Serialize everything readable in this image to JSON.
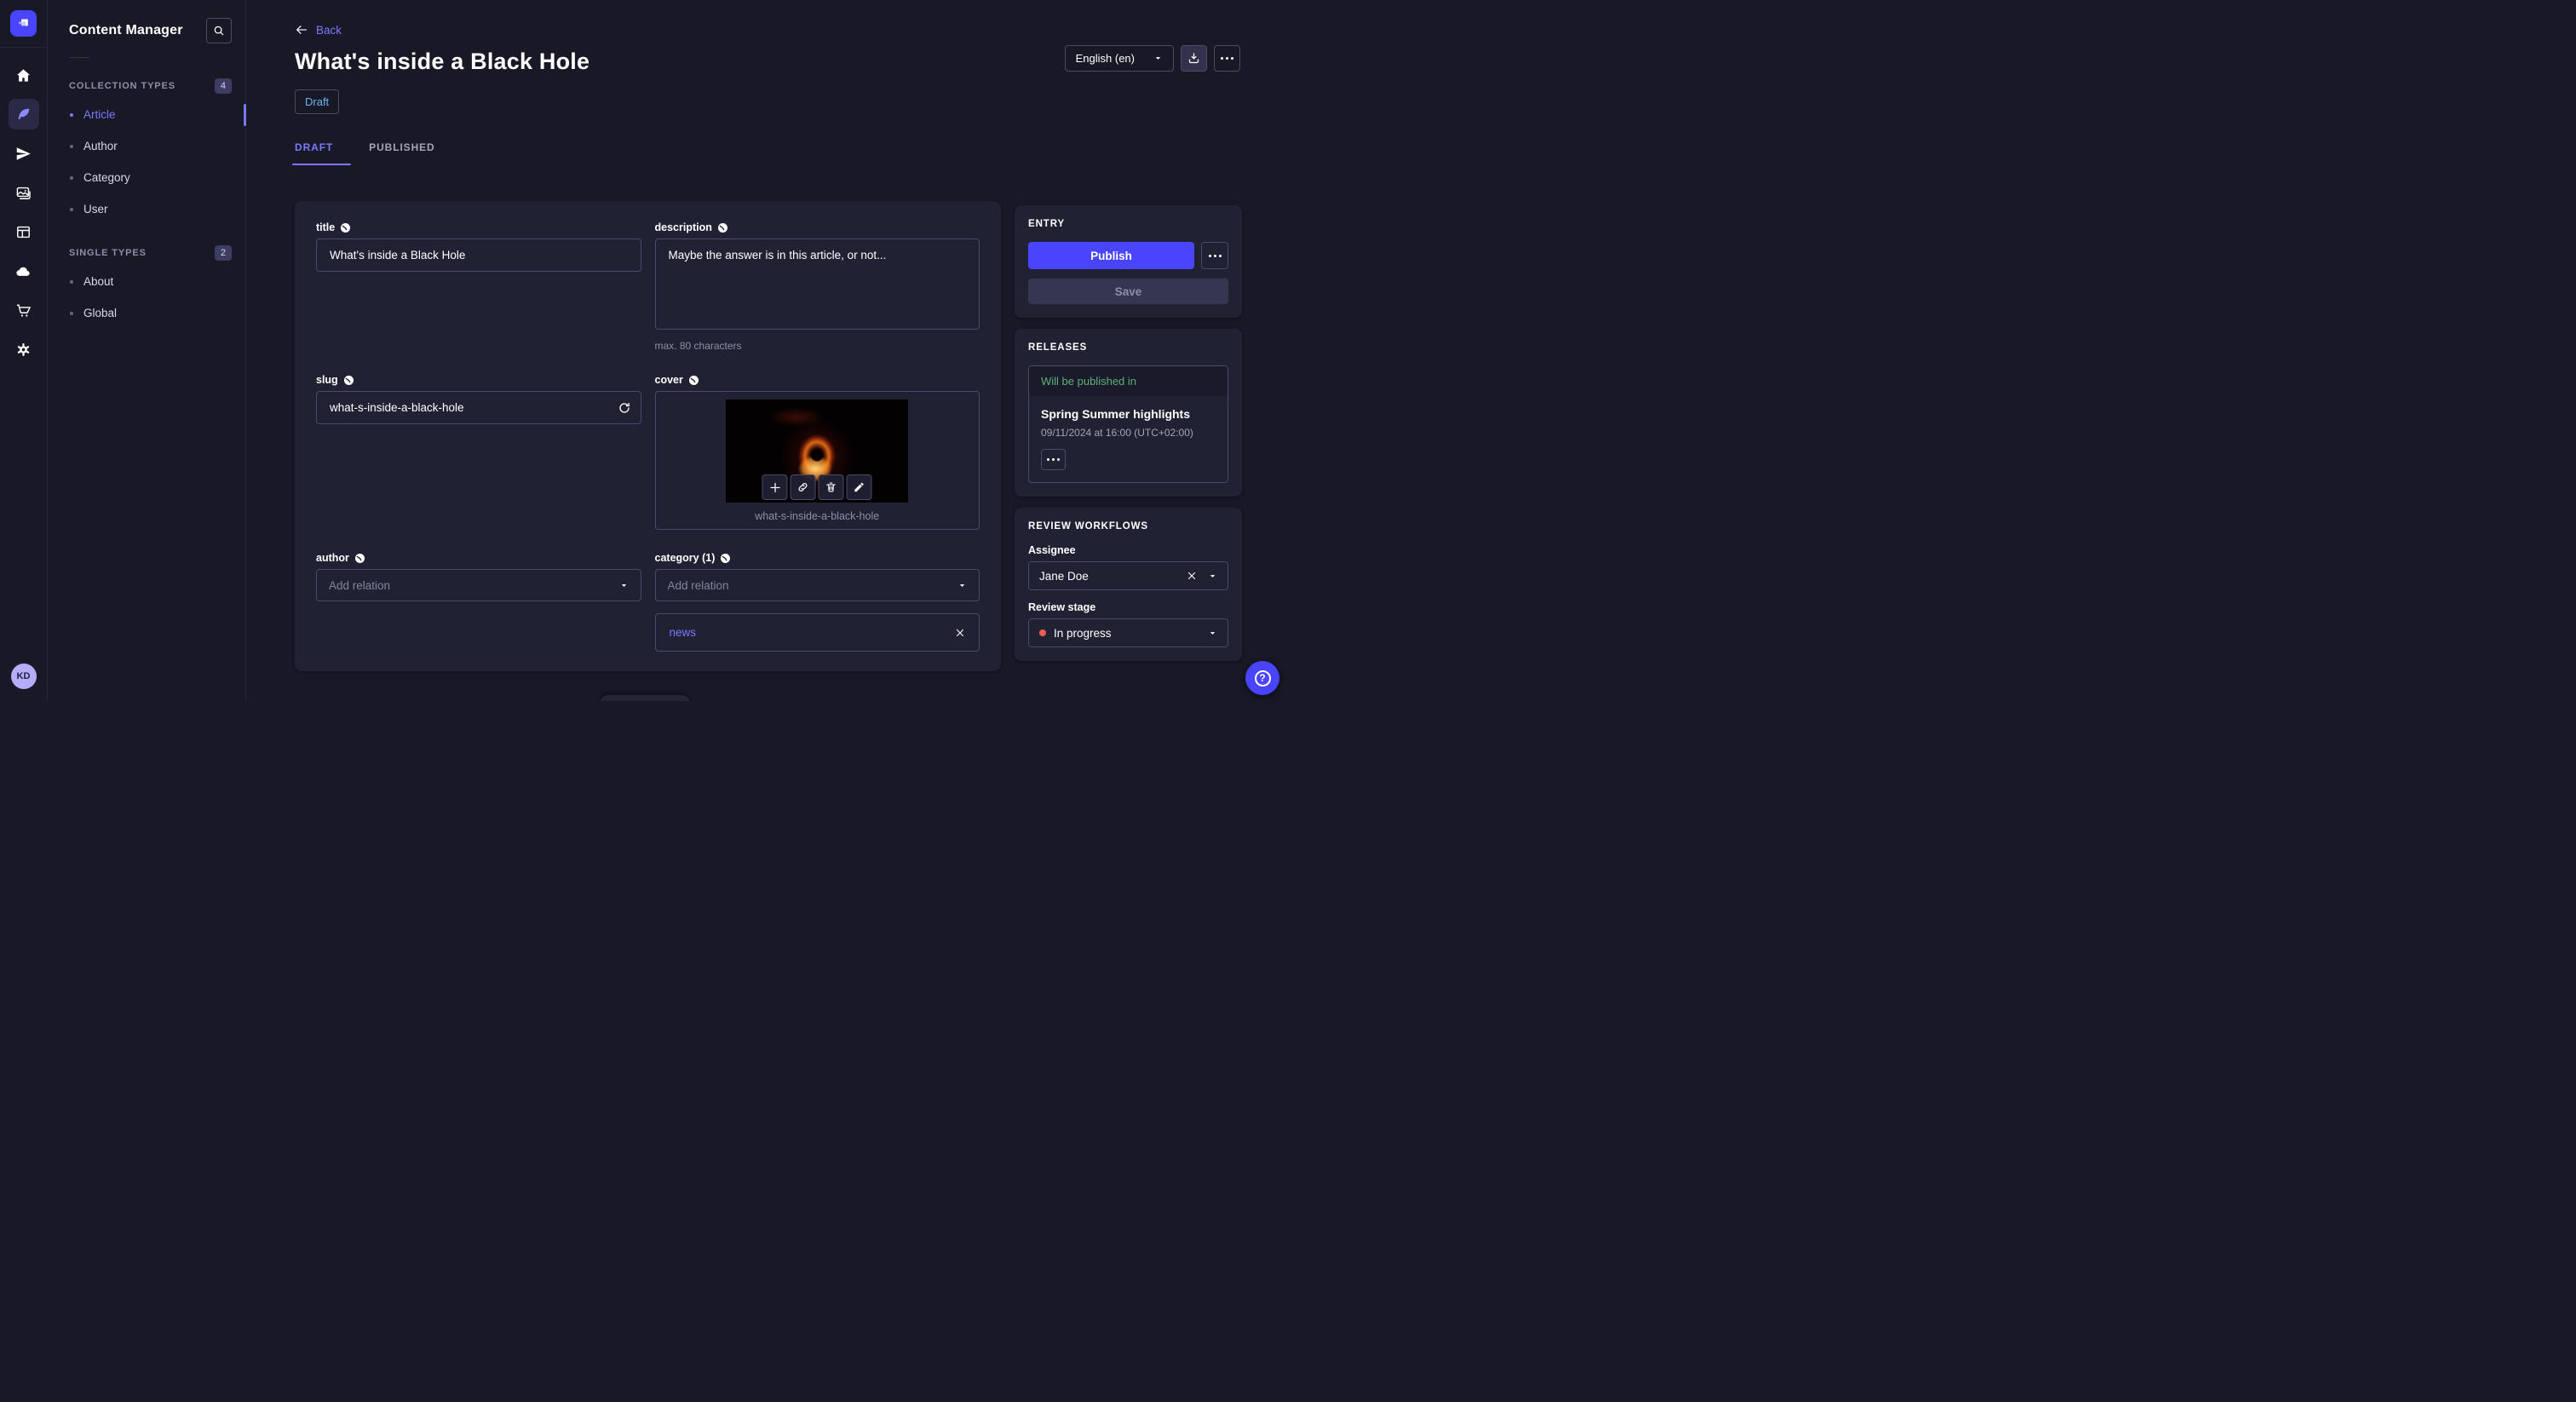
{
  "app": {
    "name": "Content Manager"
  },
  "nav": {
    "collection_label": "COLLECTION TYPES",
    "collection_count": "4",
    "collection_items": [
      {
        "label": "Article",
        "active": true
      },
      {
        "label": "Author",
        "active": false
      },
      {
        "label": "Category",
        "active": false
      },
      {
        "label": "User",
        "active": false
      }
    ],
    "single_label": "SINGLE TYPES",
    "single_count": "2",
    "single_items": [
      {
        "label": "About",
        "active": false
      },
      {
        "label": "Global",
        "active": false
      }
    ]
  },
  "header": {
    "back": "Back",
    "title": "What's inside a Black Hole",
    "status": "Draft",
    "locale": "English (en)"
  },
  "tabs": {
    "draft": "DRAFT",
    "published": "PUBLISHED"
  },
  "form": {
    "title": {
      "label": "title",
      "value": "What's inside a Black Hole"
    },
    "description": {
      "label": "description",
      "value": "Maybe the answer is in this article, or not...",
      "hint": "max. 80 characters"
    },
    "slug": {
      "label": "slug",
      "value": "what-s-inside-a-black-hole"
    },
    "cover": {
      "label": "cover",
      "filename": "what-s-inside-a-black-hole"
    },
    "author": {
      "label": "author",
      "placeholder": "Add relation"
    },
    "category": {
      "label": "category (1)",
      "placeholder": "Add relation",
      "relations": [
        "news"
      ]
    }
  },
  "entry_panel": {
    "heading": "ENTRY",
    "publish": "Publish",
    "save": "Save"
  },
  "releases_panel": {
    "heading": "RELEASES",
    "status": "Will be published in",
    "release_name": "Spring Summer highlights",
    "release_date": "09/11/2024 at 16:00 (UTC+02:00)"
  },
  "review_panel": {
    "heading": "REVIEW WORKFLOWS",
    "assignee_label": "Assignee",
    "assignee_value": "Jane Doe",
    "stage_label": "Review stage",
    "stage_value": "In progress"
  },
  "user": {
    "initials": "KD"
  },
  "colors": {
    "primary": "#4945ff",
    "link": "#7b79ff",
    "draft": "#66b7f1",
    "success": "#5cb176",
    "danger": "#ee5e52"
  }
}
